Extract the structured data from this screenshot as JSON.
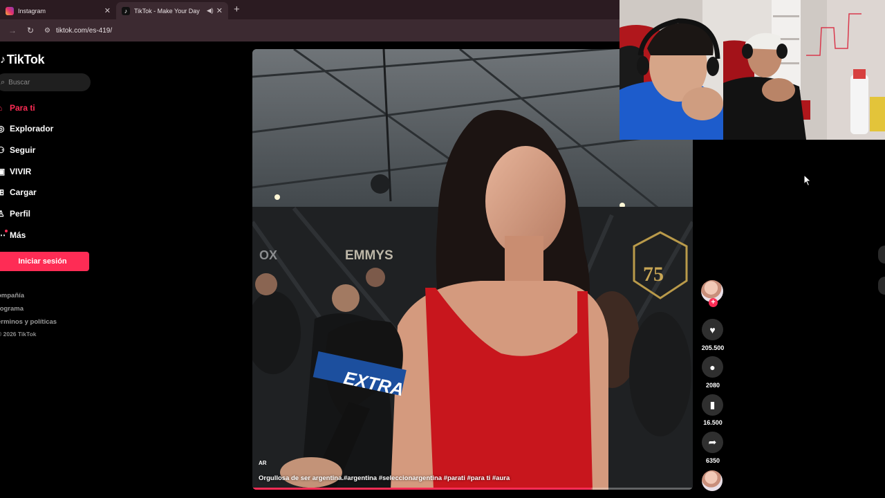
{
  "browser": {
    "tabs": [
      {
        "title": "Instagram",
        "favicon_color": "#e1306c",
        "active": false
      },
      {
        "title": "TikTok - Make Your Day",
        "favicon_color": "#111111",
        "active": true
      }
    ],
    "url": "tiktok.com/es-419/",
    "chrome_color": "#3c2a31"
  },
  "sidebar": {
    "brand": "TikTok",
    "search_placeholder": "Buscar",
    "nav": [
      {
        "label": "Para ti",
        "icon": "home-icon",
        "active": true
      },
      {
        "label": "Explorador",
        "icon": "compass-icon"
      },
      {
        "label": "Seguir",
        "icon": "following-icon"
      },
      {
        "label": "VIVIR",
        "icon": "live-icon"
      },
      {
        "label": "Cargar",
        "icon": "upload-icon"
      },
      {
        "label": "Perfil",
        "icon": "profile-icon"
      },
      {
        "label": "Más",
        "icon": "more-icon"
      }
    ],
    "login_label": "Iniciar sesión",
    "footer_links": [
      "ompañía",
      "rograma",
      "érminos y políticas"
    ],
    "copyright": "© 2026 TikTok",
    "accent": "#fe2c55"
  },
  "video": {
    "caption": "Orgullosa de ser argentina.#argentina #seleccionargentina #parati #para ti #aura",
    "watermark": "AR",
    "backdrop_text": [
      "EMMYS",
      "EXTRA",
      "75"
    ],
    "progress": 0.77
  },
  "actions": {
    "likes": "205.500",
    "comments": "2080",
    "saves": "16.500",
    "shares": "6350"
  }
}
